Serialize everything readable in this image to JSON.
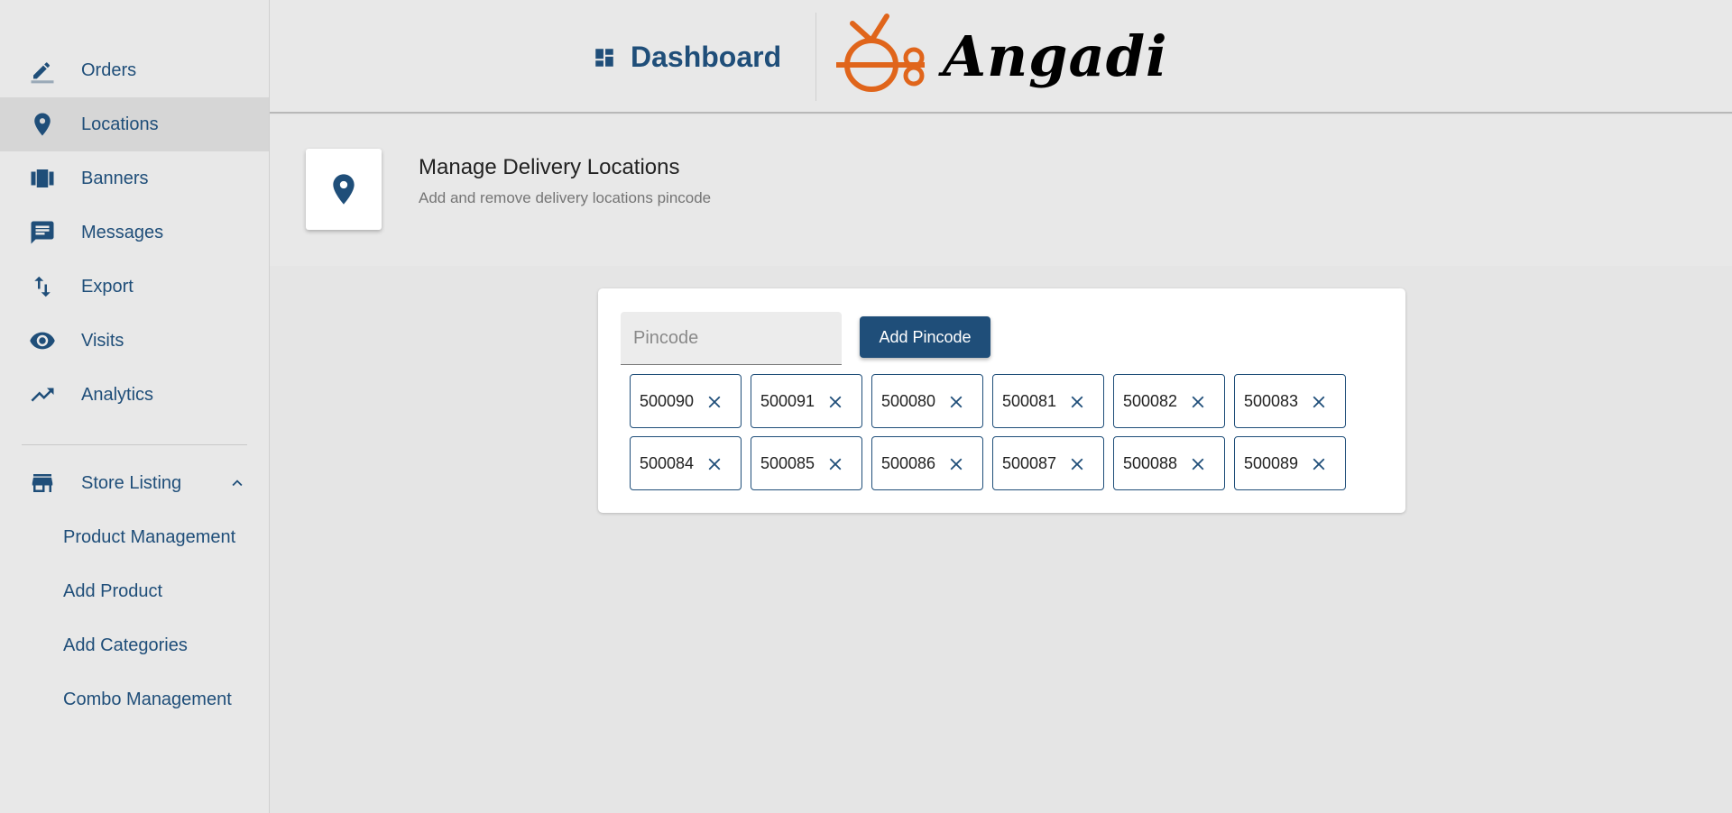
{
  "sidebar": {
    "items": [
      {
        "label": "Orders",
        "icon": "edit-icon"
      },
      {
        "label": "Locations",
        "icon": "location-pin-icon",
        "active": true
      },
      {
        "label": "Banners",
        "icon": "carousel-icon"
      },
      {
        "label": "Messages",
        "icon": "message-icon"
      },
      {
        "label": "Export",
        "icon": "swap-vertical-icon"
      },
      {
        "label": "Visits",
        "icon": "eye-icon"
      },
      {
        "label": "Analytics",
        "icon": "trending-up-icon"
      }
    ],
    "store_listing": {
      "label": "Store Listing",
      "icon": "store-icon",
      "expanded": true,
      "children": [
        {
          "label": "Product Management"
        },
        {
          "label": "Add Product"
        },
        {
          "label": "Add Categories"
        },
        {
          "label": "Combo Management"
        }
      ]
    }
  },
  "header": {
    "dashboard_label": "Dashboard",
    "brand": "Angadi"
  },
  "page": {
    "title": "Manage Delivery Locations",
    "subtitle": "Add and remove delivery locations pincode"
  },
  "pincode_form": {
    "placeholder": "Pincode",
    "value": "",
    "add_label": "Add Pincode"
  },
  "pincodes": [
    "500090",
    "500091",
    "500080",
    "500081",
    "500082",
    "500083",
    "500084",
    "500085",
    "500086",
    "500087",
    "500088",
    "500089"
  ],
  "colors": {
    "primary": "#1f4e79",
    "logo_orange": "#e0651b",
    "sidebar_bg": "#e8e8e8",
    "active_bg": "#d6d6d6"
  }
}
